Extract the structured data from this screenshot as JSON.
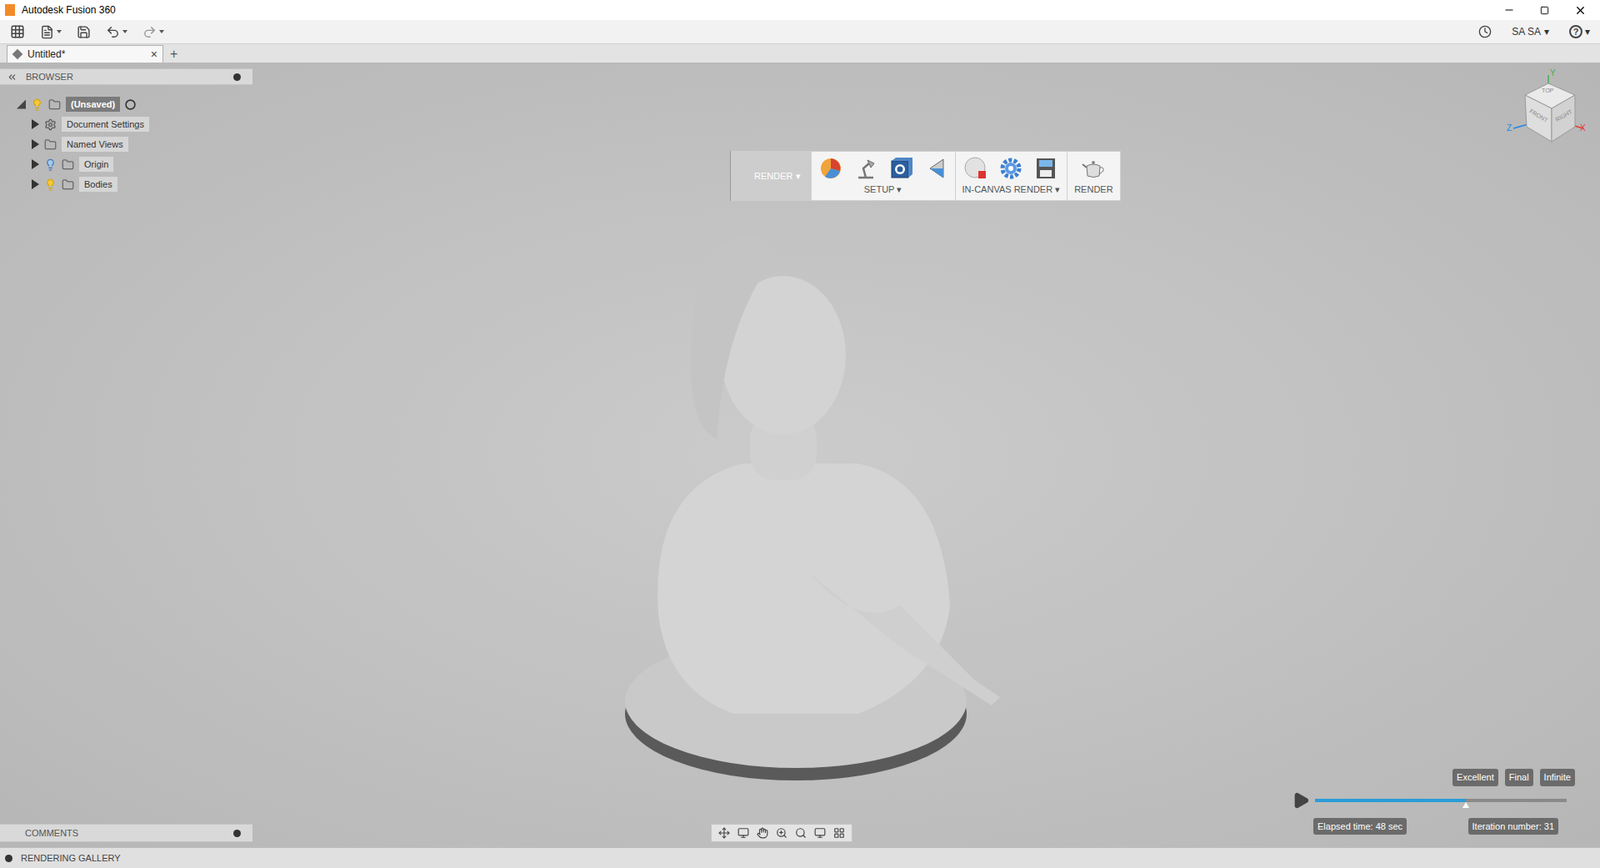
{
  "window": {
    "title": "Autodesk Fusion 360"
  },
  "account": {
    "user": "SA SA",
    "caret": "▾",
    "help": "?"
  },
  "tabs": [
    {
      "label": "Untitled*",
      "selected": true,
      "close": "×"
    }
  ],
  "new_tab": "+",
  "browser": {
    "title": "BROWSER",
    "items": [
      {
        "label": "(Unsaved)",
        "kind": "root",
        "expanded": true,
        "visible": true,
        "selected": true
      },
      {
        "label": "Document Settings",
        "kind": "settings",
        "expanded": false,
        "visible": false,
        "selected": false
      },
      {
        "label": "Named Views",
        "kind": "folder",
        "expanded": false,
        "visible": false,
        "selected": false
      },
      {
        "label": "Origin",
        "kind": "bulbfolder",
        "expanded": false,
        "visible": false,
        "selected": false
      },
      {
        "label": "Bodies",
        "kind": "bulbfolder",
        "expanded": false,
        "visible": true,
        "selected": false
      }
    ]
  },
  "workspace": {
    "label": "RENDER",
    "caret": "▾"
  },
  "render_toolbar": {
    "groups": [
      {
        "label": "SETUP ▾",
        "tools": [
          "appearance",
          "lamp",
          "decal",
          "texture"
        ]
      },
      {
        "label": "IN-CANVAS RENDER ▾",
        "tools": [
          "record",
          "settings",
          "capture"
        ]
      },
      {
        "label": "RENDER",
        "tools": [
          "teapot"
        ]
      }
    ]
  },
  "viewcube": {
    "faces": [
      "TOP",
      "FRONT",
      "RIGHT"
    ],
    "axes": [
      "X",
      "Y",
      "Z"
    ]
  },
  "render_progress": {
    "marks": [
      "Excellent",
      "Final",
      "Infinite"
    ],
    "level": 0.6,
    "elapsed": "Elapsed time: 48 sec",
    "iteration": "Iteration number: 31"
  },
  "comments": {
    "title": "COMMENTS"
  },
  "gallery": {
    "title": "RENDERING GALLERY"
  }
}
